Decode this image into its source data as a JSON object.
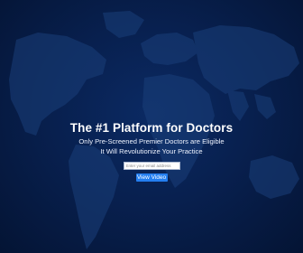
{
  "hero": {
    "headline": "The #1 Platform for Doctors",
    "subline_1": "Only Pre-Screened Premier Doctors are Eligible",
    "subline_2": "It Will Revolutionize Your Practice"
  },
  "form": {
    "email_placeholder": "Enter your email address",
    "button_label": "View Video"
  },
  "colors": {
    "background": "#05163a",
    "map": "#1a3f7a",
    "button": "#247ff0",
    "text": "#ffffff"
  }
}
